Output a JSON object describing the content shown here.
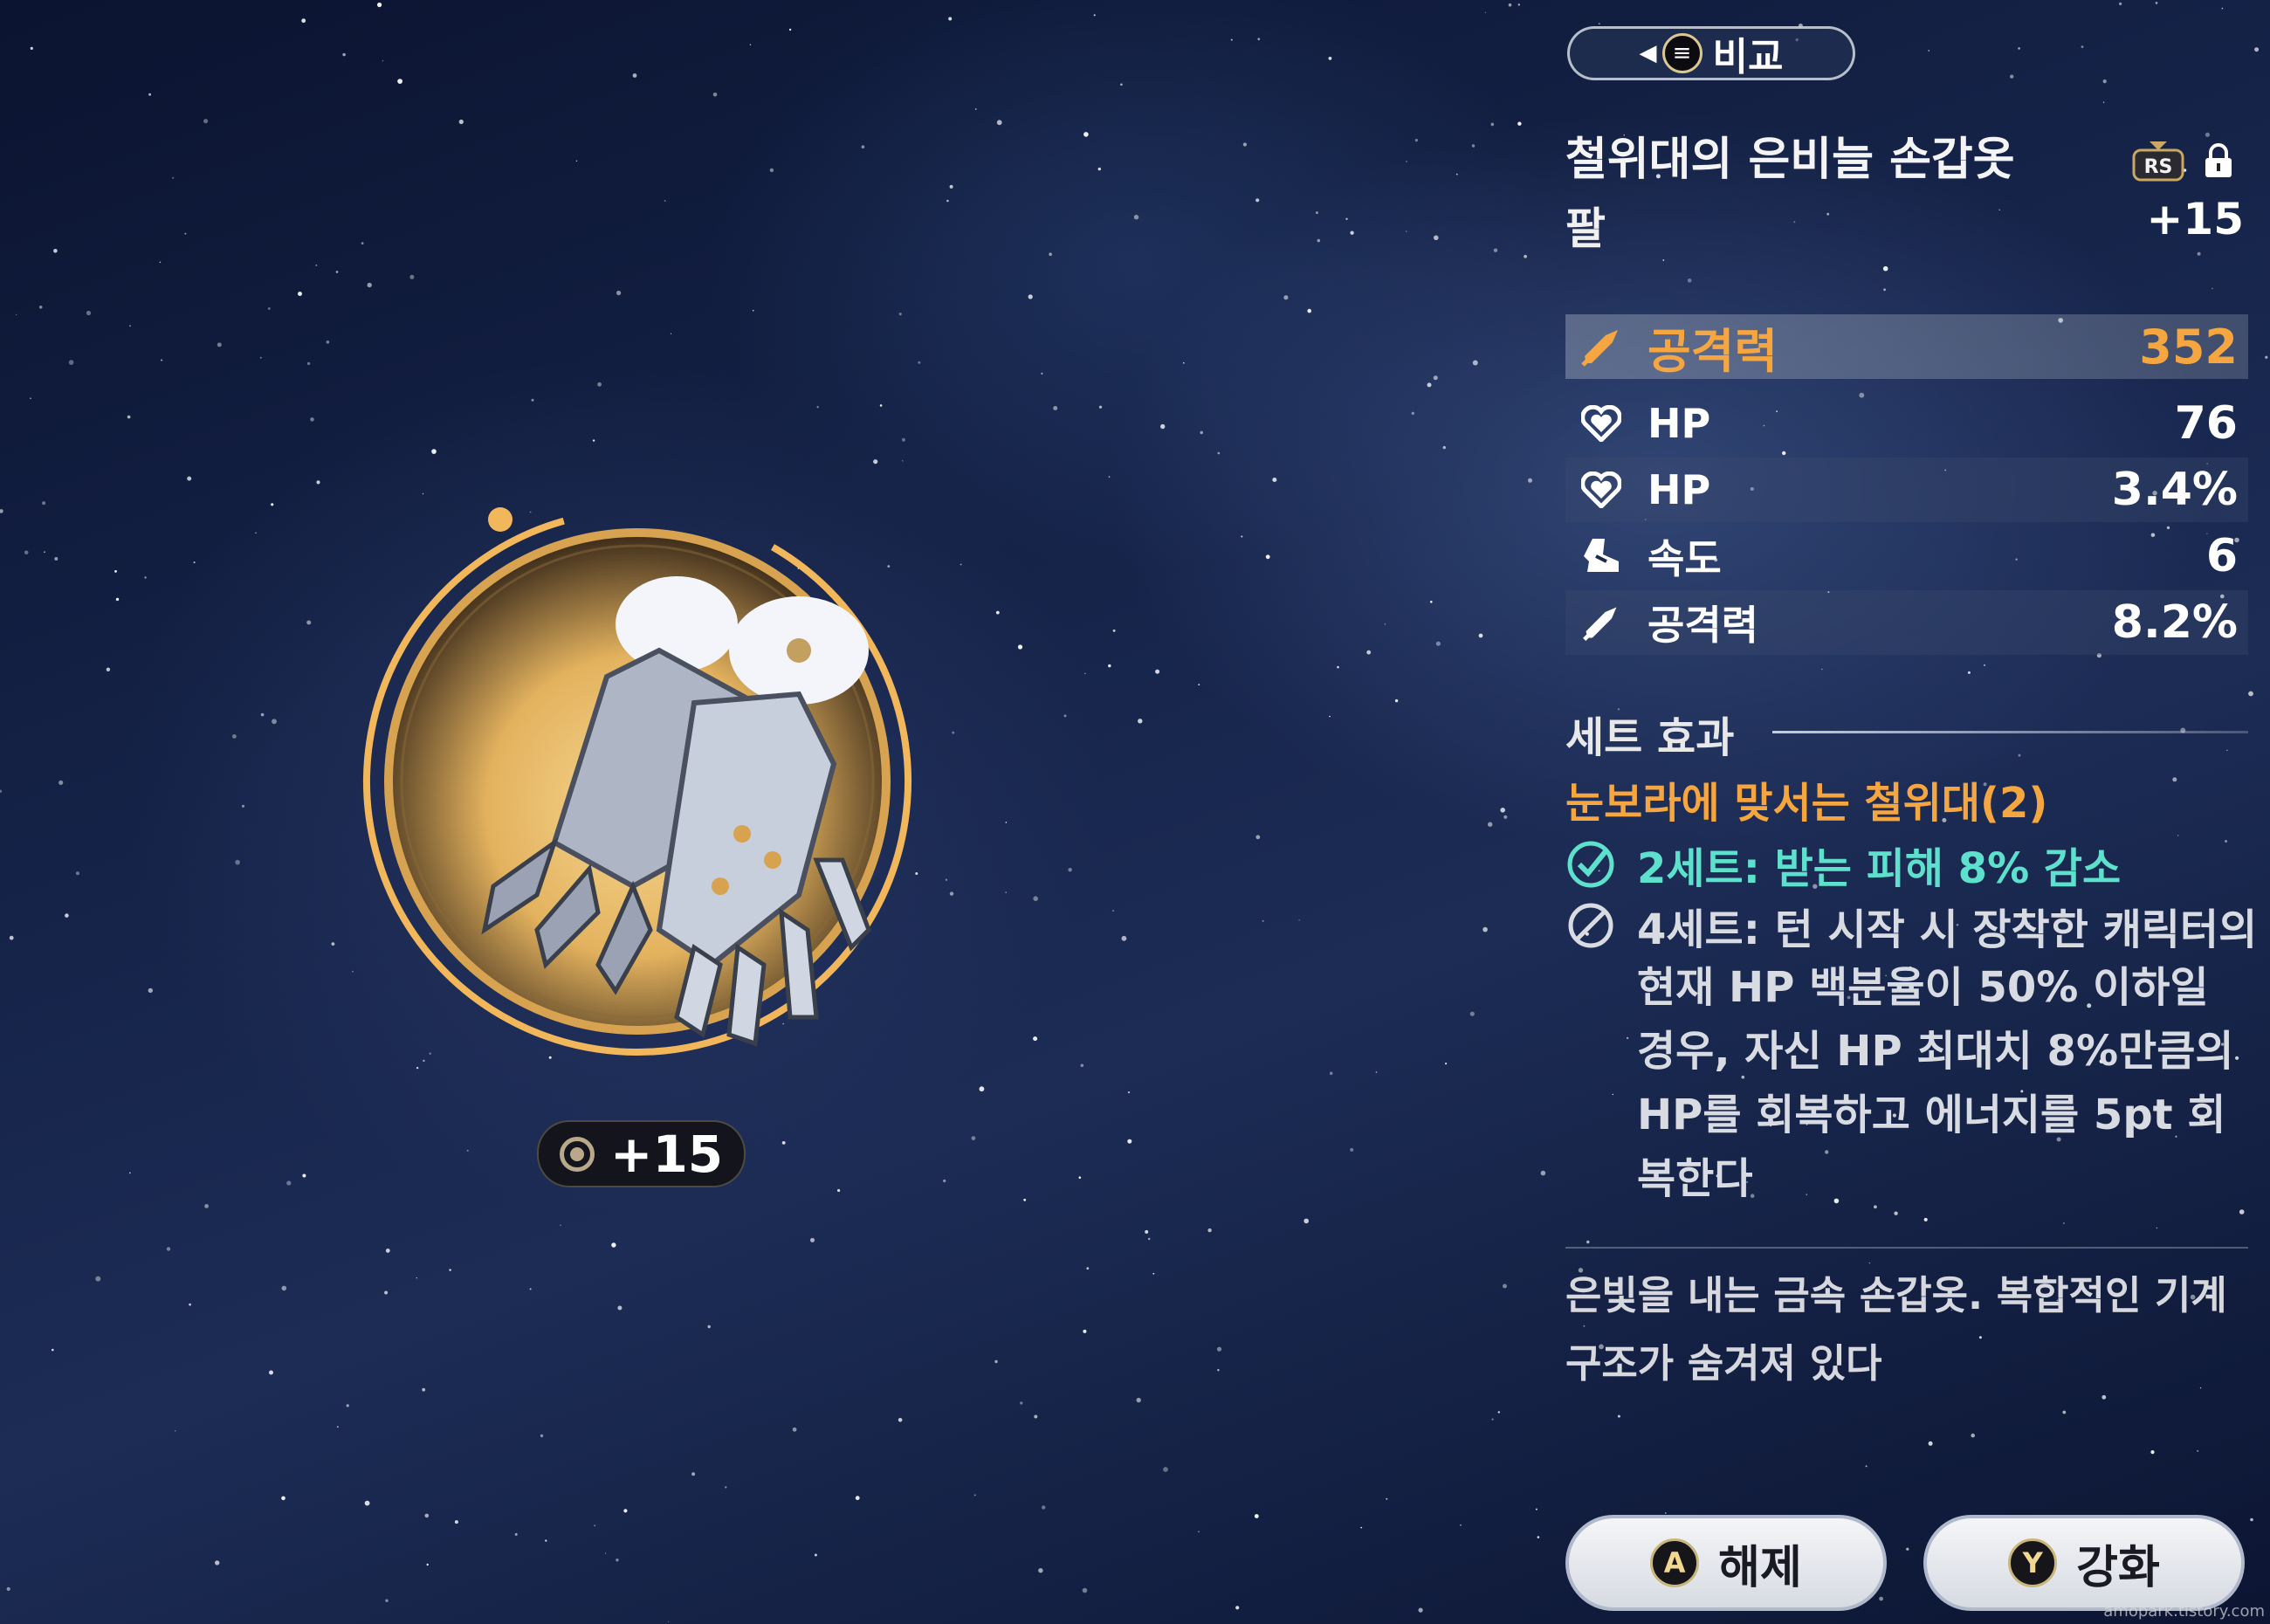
{
  "header": {
    "compare_label": "비교"
  },
  "item": {
    "name": "철위대의 은비늘 손갑옷",
    "slot": "팔",
    "level": "+15",
    "badge_text": "RS",
    "emblem_level": "+15"
  },
  "stats": [
    {
      "icon": "sword-icon",
      "name": "공격력",
      "value": "352",
      "main": true
    },
    {
      "icon": "heart-icon",
      "name": "HP",
      "value": "76"
    },
    {
      "icon": "heart-icon",
      "name": "HP",
      "value": "3.4%"
    },
    {
      "icon": "boot-icon",
      "name": "속도",
      "value": "6"
    },
    {
      "icon": "sword-icon",
      "name": "공격력",
      "value": "8.2%"
    }
  ],
  "set_effect": {
    "header": "세트 효과",
    "name": "눈보라에 맞서는 철위대(2)",
    "two_piece": "2세트: 받는 피해 8% 감소",
    "four_piece_first": "4세트: 턴 시작 시 장착한 캐릭터의",
    "four_piece_rest": "현재 HP 백분율이 50% 이하일 경우, 자신 HP 최대치 8%만큼의 HP를 회복하고 에너지를 5pt 회복한다"
  },
  "description": "은빛을 내는 금속 손갑옷. 복합적인 기계 구조가 숨겨져 있다",
  "buttons": {
    "release": {
      "key": "A",
      "label": "해제"
    },
    "enhance": {
      "key": "Y",
      "label": "강화"
    }
  },
  "watermark": "amopark.tistory.com",
  "colors": {
    "accent": "#f5a640",
    "active_set": "#5de0cc",
    "emblem_gold": "#f2b75a"
  }
}
